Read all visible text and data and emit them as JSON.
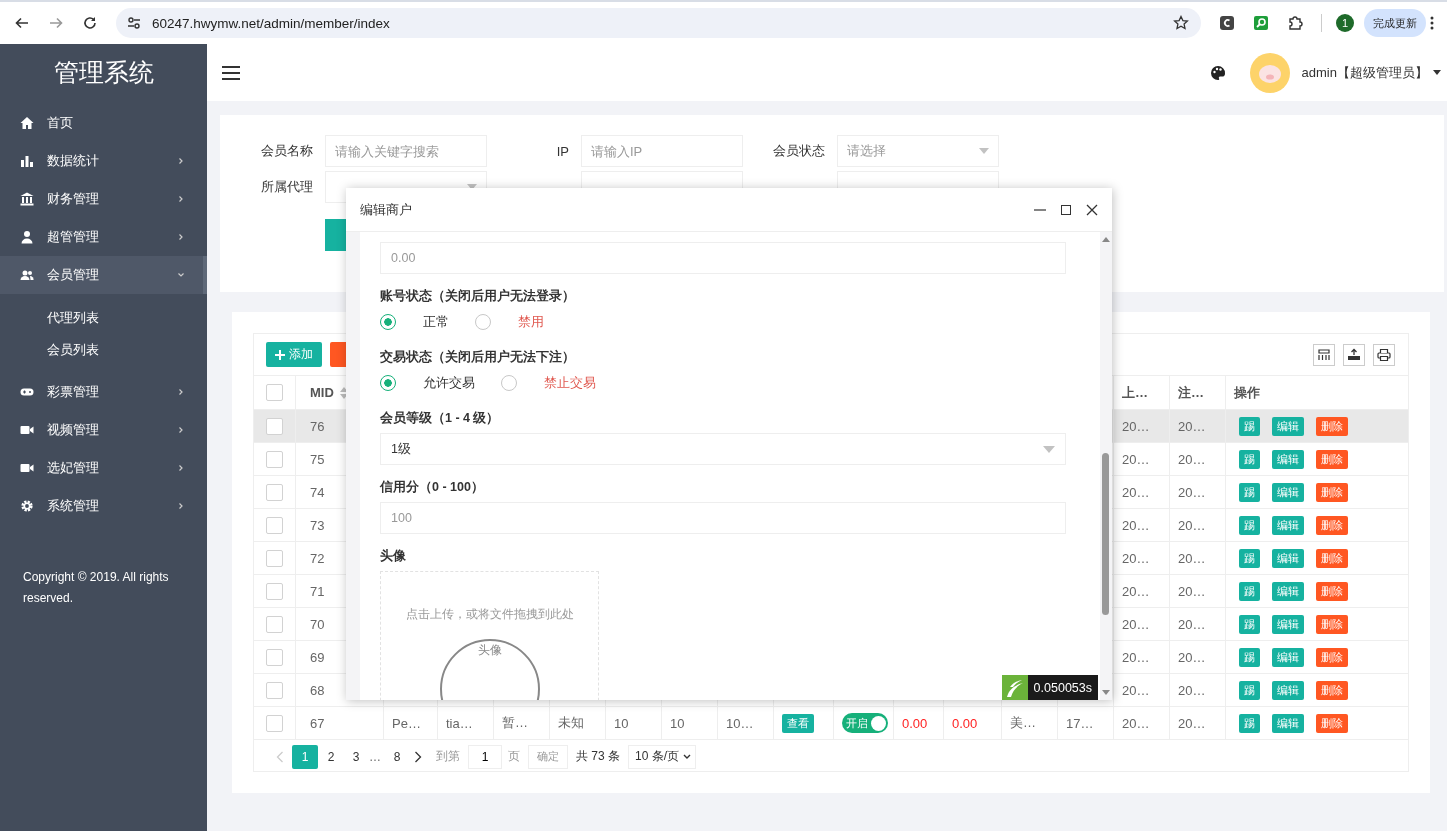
{
  "browser": {
    "url": "60247.hwymw.net/admin/member/index",
    "profile": "1",
    "update_button": "完成更新"
  },
  "sidebar": {
    "title": "管理系统",
    "items": [
      {
        "label": "首页",
        "has_children": false,
        "expanded": false
      },
      {
        "label": "数据统计",
        "has_children": true,
        "expanded": false
      },
      {
        "label": "财务管理",
        "has_children": true,
        "expanded": false
      },
      {
        "label": "超管管理",
        "has_children": true,
        "expanded": false
      },
      {
        "label": "会员管理",
        "has_children": true,
        "expanded": true,
        "children": [
          {
            "label": "代理列表"
          },
          {
            "label": "会员列表"
          }
        ]
      },
      {
        "label": "彩票管理",
        "has_children": true,
        "expanded": false
      },
      {
        "label": "视频管理",
        "has_children": true,
        "expanded": false
      },
      {
        "label": "选妃管理",
        "has_children": true,
        "expanded": false
      },
      {
        "label": "系统管理",
        "has_children": true,
        "expanded": false
      }
    ],
    "copyright": "Copyright © 2019. All rights reserved."
  },
  "header": {
    "user": "admin【超级管理员】"
  },
  "filters": [
    {
      "label": "会员名称",
      "placeholder": "请输入关键字搜索",
      "kind": "input"
    },
    {
      "label": "IP",
      "placeholder": "请输入IP",
      "kind": "input"
    },
    {
      "label": "会员状态",
      "placeholder": "请选择",
      "kind": "select"
    },
    {
      "label": "所属代理",
      "kind": "select"
    },
    {
      "kind": "input"
    },
    {
      "kind": "input"
    }
  ],
  "table": {
    "add_button": "添加",
    "header": {
      "checked": false,
      "mid": {
        "label": "MID",
        "sortable": true
      },
      "column_15": "上…",
      "column_16": "注…",
      "actions": "操作"
    },
    "rows": [
      {
        "mid": "76",
        "checked": false,
        "highlighted": true,
        "column_15": "20…",
        "column_16": "20…",
        "actions": [
          {
            "label": "踢",
            "kind": "primary"
          },
          {
            "label": "编辑",
            "kind": "primary"
          },
          {
            "label": "删除",
            "kind": "danger"
          }
        ]
      },
      {
        "mid": "75",
        "checked": false,
        "highlighted": false,
        "column_15": "20…",
        "column_16": "20…",
        "actions": [
          {
            "label": "踢",
            "kind": "primary"
          },
          {
            "label": "编辑",
            "kind": "primary"
          },
          {
            "label": "删除",
            "kind": "danger"
          }
        ]
      },
      {
        "mid": "74",
        "checked": false,
        "highlighted": false,
        "column_15": "20…",
        "column_16": "20…",
        "actions": [
          {
            "label": "踢",
            "kind": "primary"
          },
          {
            "label": "编辑",
            "kind": "primary"
          },
          {
            "label": "删除",
            "kind": "danger"
          }
        ]
      },
      {
        "mid": "73",
        "checked": false,
        "highlighted": false,
        "column_15": "20…",
        "column_16": "20…",
        "actions": [
          {
            "label": "踢",
            "kind": "primary"
          },
          {
            "label": "编辑",
            "kind": "primary"
          },
          {
            "label": "删除",
            "kind": "danger"
          }
        ]
      },
      {
        "mid": "72",
        "checked": false,
        "highlighted": false,
        "column_15": "20…",
        "column_16": "20…",
        "actions": [
          {
            "label": "踢",
            "kind": "primary"
          },
          {
            "label": "编辑",
            "kind": "primary"
          },
          {
            "label": "删除",
            "kind": "danger"
          }
        ]
      },
      {
        "mid": "71",
        "checked": false,
        "highlighted": false,
        "column_15": "20…",
        "column_16": "20…",
        "actions": [
          {
            "label": "踢",
            "kind": "primary"
          },
          {
            "label": "编辑",
            "kind": "primary"
          },
          {
            "label": "删除",
            "kind": "danger"
          }
        ]
      },
      {
        "mid": "70",
        "checked": false,
        "highlighted": false,
        "column_15": "20…",
        "column_16": "20…",
        "actions": [
          {
            "label": "踢",
            "kind": "primary"
          },
          {
            "label": "编辑",
            "kind": "primary"
          },
          {
            "label": "删除",
            "kind": "danger"
          }
        ]
      },
      {
        "mid": "69",
        "checked": false,
        "highlighted": false,
        "column_15": "20…",
        "column_16": "20…",
        "actions": [
          {
            "label": "踢",
            "kind": "primary"
          },
          {
            "label": "编辑",
            "kind": "primary"
          },
          {
            "label": "删除",
            "kind": "danger"
          }
        ]
      },
      {
        "mid": "68",
        "checked": false,
        "highlighted": false,
        "column_15": "20…",
        "column_16": "20…",
        "actions": [
          {
            "label": "踢",
            "kind": "primary"
          },
          {
            "label": "编辑",
            "kind": "primary"
          },
          {
            "label": "删除",
            "kind": "danger"
          }
        ]
      },
      {
        "mid": "67",
        "checked": false,
        "highlighted": false,
        "cells": [
          {
            "kind": "text",
            "text": "Pe…"
          },
          {
            "kind": "text",
            "text": "tia…"
          },
          {
            "kind": "text",
            "text": "暂…"
          },
          {
            "kind": "text",
            "text": "未知"
          },
          {
            "kind": "text",
            "text": "10"
          },
          {
            "kind": "text",
            "text": "10"
          },
          {
            "kind": "text",
            "text": "10…"
          },
          {
            "kind": "button",
            "text": "查看"
          },
          {
            "kind": "switch",
            "text": "开启",
            "on": true
          },
          {
            "kind": "money",
            "text": "0.00"
          },
          {
            "kind": "money",
            "text": "0.00"
          },
          {
            "kind": "text",
            "text": "美…"
          },
          {
            "kind": "text",
            "text": "17…"
          }
        ],
        "column_15": "20…",
        "column_16": "20…",
        "actions": [
          {
            "label": "踢",
            "kind": "primary"
          },
          {
            "label": "编辑",
            "kind": "primary"
          },
          {
            "label": "删除",
            "kind": "danger"
          }
        ]
      }
    ]
  },
  "pagination": {
    "prev_disabled": true,
    "pages": [
      {
        "label": "1",
        "selected": true,
        "kind": "page"
      },
      {
        "label": "2",
        "selected": false,
        "kind": "page"
      },
      {
        "label": "3",
        "selected": false,
        "kind": "page"
      },
      {
        "label": "…",
        "kind": "ellipsis"
      },
      {
        "label": "8",
        "selected": false,
        "kind": "page"
      }
    ],
    "goto_label": "到第",
    "goto_value": "1",
    "page_unit": "页",
    "confirm": "确定",
    "total": "共 73 条",
    "page_size": "10 条/页"
  },
  "modal": {
    "title": "编辑商户",
    "fields": [
      {
        "kind": "input",
        "placeholder": "0.00"
      },
      {
        "kind": "radio",
        "label": "账号状态（关闭后用户无法登录）",
        "options": [
          {
            "label": "正常",
            "selected": true,
            "danger": false
          },
          {
            "label": "禁用",
            "selected": false,
            "danger": true
          }
        ]
      },
      {
        "kind": "radio",
        "label": "交易状态（关闭后用户无法下注）",
        "options": [
          {
            "label": "允许交易",
            "selected": true,
            "danger": false
          },
          {
            "label": "禁止交易",
            "selected": false,
            "danger": true
          }
        ]
      },
      {
        "kind": "select",
        "label": "会员等级（1 - 4 级）",
        "value": "1级"
      },
      {
        "kind": "input",
        "label": "信用分（0 - 100）",
        "placeholder": "100"
      },
      {
        "kind": "upload",
        "label": "头像",
        "hint": "点击上传，或将文件拖拽到此处",
        "preview_label": "头像"
      }
    ],
    "timer": "0.050053s"
  }
}
